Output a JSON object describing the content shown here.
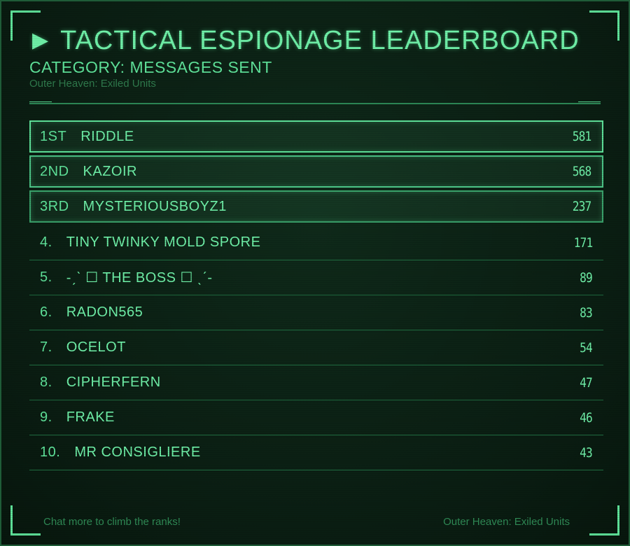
{
  "header": {
    "arrow_icon": "▶",
    "title": "TACTICAL ESPIONAGE LEADERBOARD",
    "category": "CATEGORY: MESSAGES SENT",
    "subtitle": "Outer Heaven: Exiled Units"
  },
  "leaderboard": [
    {
      "rank": "1ST",
      "name": "RIDDLE",
      "value": "581"
    },
    {
      "rank": "2ND",
      "name": "KAZOIR",
      "value": "568"
    },
    {
      "rank": "3RD",
      "name": "MYSTERIOUSBOYZ1",
      "value": "237"
    },
    {
      "rank": "4.",
      "name": "TINY TWINKY MOLD SPORE",
      "value": "171"
    },
    {
      "rank": "5.",
      "name": "-ˏˋ ☐ THE BOSS ☐ ˎˊ-",
      "value": "89"
    },
    {
      "rank": "6.",
      "name": "RADON565",
      "value": "83"
    },
    {
      "rank": "7.",
      "name": "OCELOT",
      "value": "54"
    },
    {
      "rank": "8.",
      "name": "CIPHERFERN",
      "value": "47"
    },
    {
      "rank": "9.",
      "name": "FRAKE",
      "value": "46"
    },
    {
      "rank": "10.",
      "name": "MR CONSIGLIERE",
      "value": "43"
    }
  ],
  "footer": {
    "left": "Chat more to climb the ranks!",
    "right": "Outer Heaven: Exiled Units"
  },
  "colors": {
    "background": "#0a1d12",
    "accent": "#5fe39a",
    "dim": "#2f7a4c"
  }
}
